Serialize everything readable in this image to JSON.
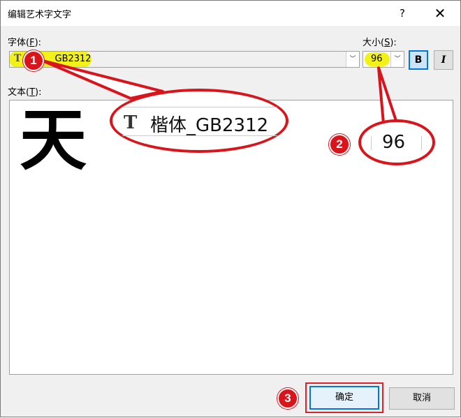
{
  "window": {
    "title": "编辑艺术字文字",
    "help_label": "?",
    "close_label": "✕"
  },
  "font": {
    "label_prefix": "字体(",
    "label_key": "F",
    "label_suffix": "):",
    "value": "楷体_GB2312",
    "visible_value": "_GB2312",
    "icon": "truetype-icon",
    "icon_glyph": "T"
  },
  "size": {
    "label_prefix": "大小(",
    "label_key": "S",
    "label_suffix": "):",
    "value": "96"
  },
  "style_buttons": {
    "bold": "B",
    "italic": "I"
  },
  "text": {
    "label_prefix": "文本(",
    "label_key": "T",
    "label_suffix": "):",
    "content": "天"
  },
  "buttons": {
    "ok": "确定",
    "cancel": "取消"
  },
  "annotations": {
    "highlight_color": "#f2f21a",
    "callout_color": "#d9141b",
    "badge_1": "1",
    "badge_2": "2",
    "badge_3": "3",
    "zoom_font_text": "楷体_GB2312",
    "zoom_size_text": "96"
  },
  "combo_arrow_glyph": "﹀"
}
